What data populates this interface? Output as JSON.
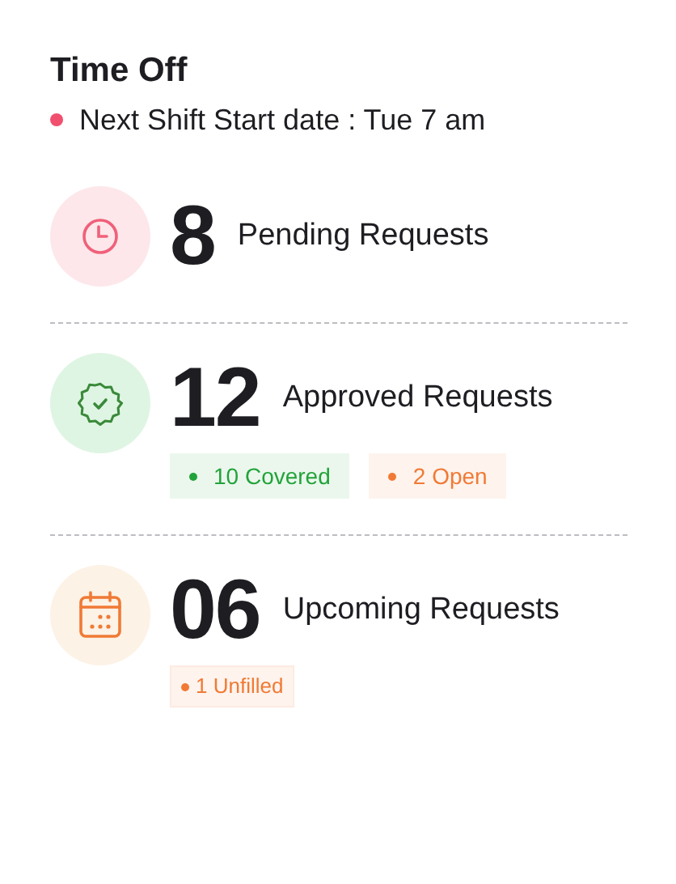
{
  "title": "Time Off",
  "next_shift": {
    "text": "Next Shift Start date : Tue 7 am",
    "color": "#f0506e"
  },
  "requests": [
    {
      "kind": "clock",
      "count": "8",
      "label": "Pending Requests"
    },
    {
      "kind": "badge",
      "count": "12",
      "label": "Approved Requests",
      "tags": [
        {
          "text": "10 Covered",
          "color": "#22a33a"
        },
        {
          "text": "2 Open",
          "color": "#f07a35"
        }
      ]
    },
    {
      "kind": "calendar",
      "count": "06",
      "label": "Upcoming Requests",
      "tags": [
        {
          "text": "1 Unfilled",
          "color": "#f07a35"
        }
      ]
    }
  ]
}
